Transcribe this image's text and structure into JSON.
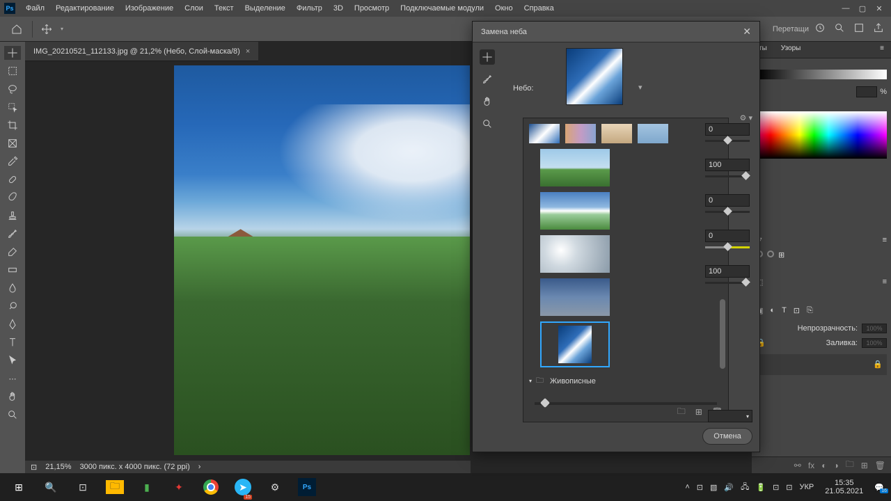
{
  "menubar": {
    "logo": "Ps",
    "items": [
      "Файл",
      "Редактирование",
      "Изображение",
      "Слои",
      "Текст",
      "Выделение",
      "Фильтр",
      "3D",
      "Просмотр",
      "Подключаемые модули",
      "Окно",
      "Справка"
    ]
  },
  "options": {
    "drag_text": "Перетащи"
  },
  "document": {
    "tab_title": "IMG_20210521_112133.jpg @ 21,2% (Небо, Слой-маска/8)"
  },
  "status": {
    "zoom": "21,15%",
    "dims": "3000 пикс. x 4000 пикс. (72 ppi)",
    "arrow": "›"
  },
  "dialog": {
    "title": "Замена неба",
    "sky_label": "Небо:",
    "category": "Живописные",
    "values": {
      "v1": "0",
      "v2": "100",
      "v3": "0",
      "v4": "0",
      "v5": "100"
    },
    "cancel": "Отмена"
  },
  "right_panel": {
    "tab_ty": "ты",
    "tab_uzory": "Узоры",
    "pct_sym": "%",
    "opacity_label": "Непрозрачность:",
    "opacity_val": "100%",
    "fill_label": "Заливка:",
    "fill_val": "100%"
  },
  "taskbar": {
    "lang": "УКР",
    "time": "15:35",
    "date": "21.05.2021",
    "notif_badge": "16",
    "tg_badge": "15"
  }
}
